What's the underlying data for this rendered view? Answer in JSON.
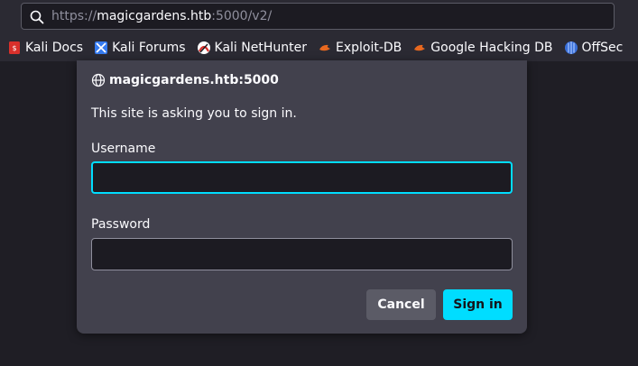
{
  "urlbar": {
    "scheme": "https://",
    "host": "magicgardens.htb",
    "rest": ":5000/v2/"
  },
  "bookmarks": [
    {
      "label": "Kali Docs",
      "icon": "kali-docs-icon",
      "color": "#d9302b"
    },
    {
      "label": "Kali Forums",
      "icon": "kali-forums-icon",
      "color": "#367bf0"
    },
    {
      "label": "Kali NetHunter",
      "icon": "kali-nethunter-icon",
      "color": "#d9302b"
    },
    {
      "label": "Exploit-DB",
      "icon": "exploit-db-icon",
      "color": "#e8681f"
    },
    {
      "label": "Google Hacking DB",
      "icon": "ghdb-icon",
      "color": "#e8681f"
    },
    {
      "label": "OffSec",
      "icon": "offsec-icon",
      "color": "#3a6fd8"
    }
  ],
  "dialog": {
    "origin": "magicgardens.htb:5000",
    "message": "This site is asking you to sign in.",
    "username_label": "Username",
    "username_value": "",
    "password_label": "Password",
    "password_value": "",
    "cancel_label": "Cancel",
    "signin_label": "Sign in"
  },
  "colors": {
    "accent": "#00ddff"
  }
}
